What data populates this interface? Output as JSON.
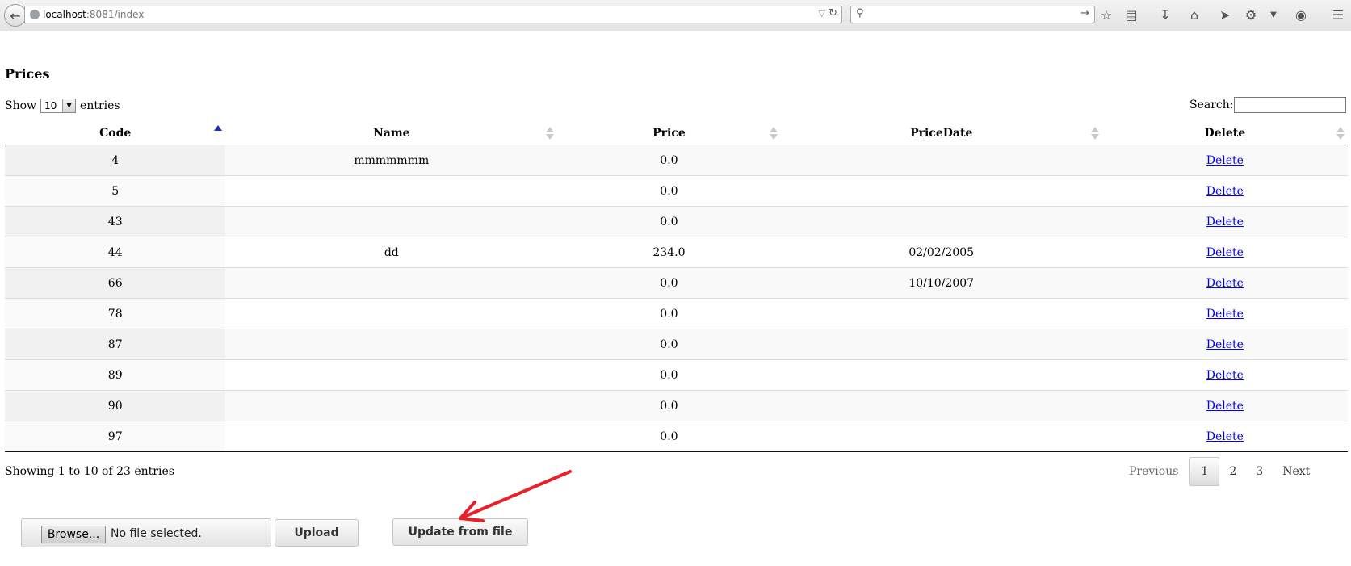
{
  "browser": {
    "url_host": "localhost",
    "url_rest": ":8081/index",
    "search_placeholder": ""
  },
  "page": {
    "title": "Prices",
    "show_label": "Show",
    "page_length": "10",
    "entries_label": "entries",
    "search_label": "Search:",
    "search_value": ""
  },
  "table": {
    "columns": [
      "Code",
      "Name",
      "Price",
      "PriceDate",
      "Delete"
    ],
    "sorted_column": "Code",
    "rows": [
      {
        "code": "4",
        "name": "mmmmmmm",
        "price": "0.0",
        "date": "",
        "action": "Delete"
      },
      {
        "code": "5",
        "name": "",
        "price": "0.0",
        "date": "",
        "action": "Delete"
      },
      {
        "code": "43",
        "name": "",
        "price": "0.0",
        "date": "",
        "action": "Delete"
      },
      {
        "code": "44",
        "name": "dd",
        "price": "234.0",
        "date": "02/02/2005",
        "action": "Delete"
      },
      {
        "code": "66",
        "name": "",
        "price": "0.0",
        "date": "10/10/2007",
        "action": "Delete"
      },
      {
        "code": "78",
        "name": "",
        "price": "0.0",
        "date": "",
        "action": "Delete"
      },
      {
        "code": "87",
        "name": "",
        "price": "0.0",
        "date": "",
        "action": "Delete"
      },
      {
        "code": "89",
        "name": "",
        "price": "0.0",
        "date": "",
        "action": "Delete"
      },
      {
        "code": "90",
        "name": "",
        "price": "0.0",
        "date": "",
        "action": "Delete"
      },
      {
        "code": "97",
        "name": "",
        "price": "0.0",
        "date": "",
        "action": "Delete"
      }
    ]
  },
  "footer": {
    "info": "Showing 1 to 10 of 23 entries",
    "previous": "Previous",
    "pages": [
      "1",
      "2",
      "3"
    ],
    "current_page": "1",
    "next": "Next"
  },
  "form": {
    "browse_label": "Browse...",
    "file_status": "No file selected.",
    "upload_label": "Upload",
    "update_label": "Update from file"
  },
  "colors": {
    "annotation_arrow": "#e8202a",
    "link": "#0000ee",
    "sort_active": "#1f2bb8"
  }
}
